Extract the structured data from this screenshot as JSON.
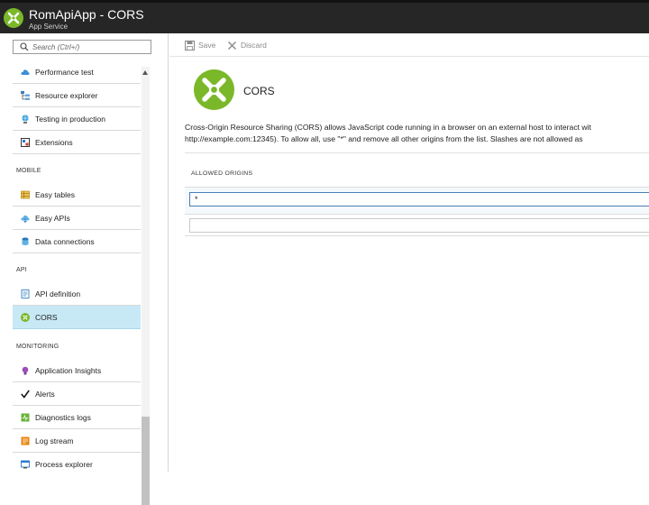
{
  "header": {
    "title": "RomApiApp - CORS",
    "subtitle": "App Service"
  },
  "search": {
    "placeholder": "Search (Ctrl+/)"
  },
  "sidebar": {
    "items_top": [
      {
        "label": "Performance test",
        "icon": "cloud-icon"
      },
      {
        "label": "Resource explorer",
        "icon": "resource-explorer-icon"
      },
      {
        "label": "Testing in production",
        "icon": "globe-icon"
      },
      {
        "label": "Extensions",
        "icon": "extensions-icon"
      }
    ],
    "mobile": {
      "title": "MOBILE",
      "items": [
        {
          "label": "Easy tables",
          "icon": "table-icon"
        },
        {
          "label": "Easy APIs",
          "icon": "cloud-api-icon"
        },
        {
          "label": "Data connections",
          "icon": "database-icon"
        }
      ]
    },
    "api": {
      "title": "API",
      "items": [
        {
          "label": "API definition",
          "icon": "api-definition-icon"
        },
        {
          "label": "CORS",
          "icon": "cors-icon"
        }
      ]
    },
    "monitoring": {
      "title": "MONITORING",
      "items": [
        {
          "label": "Application Insights",
          "icon": "lightbulb-icon"
        },
        {
          "label": "Alerts",
          "icon": "checkmark-icon"
        },
        {
          "label": "Diagnostics logs",
          "icon": "diagnostics-icon"
        },
        {
          "label": "Log stream",
          "icon": "log-stream-icon"
        },
        {
          "label": "Process explorer",
          "icon": "process-explorer-icon"
        }
      ]
    },
    "active_item": "CORS"
  },
  "toolbar": {
    "save_label": "Save",
    "discard_label": "Discard"
  },
  "page": {
    "title": "CORS",
    "description_line1": "Cross-Origin Resource Sharing (CORS) allows JavaScript code running in a browser on an external host to interact wit",
    "description_line2": "http://example.com:12345). To allow all, use \"*\" and remove all other origins from the list. Slashes are not allowed as",
    "column_header": "ALLOWED ORIGINS",
    "origins": [
      "*",
      ""
    ]
  },
  "colors": {
    "topbar": "#262626",
    "brand_green": "#7ab829",
    "active_item": "#c7e9f5",
    "focus_border": "#4a7eb5"
  }
}
